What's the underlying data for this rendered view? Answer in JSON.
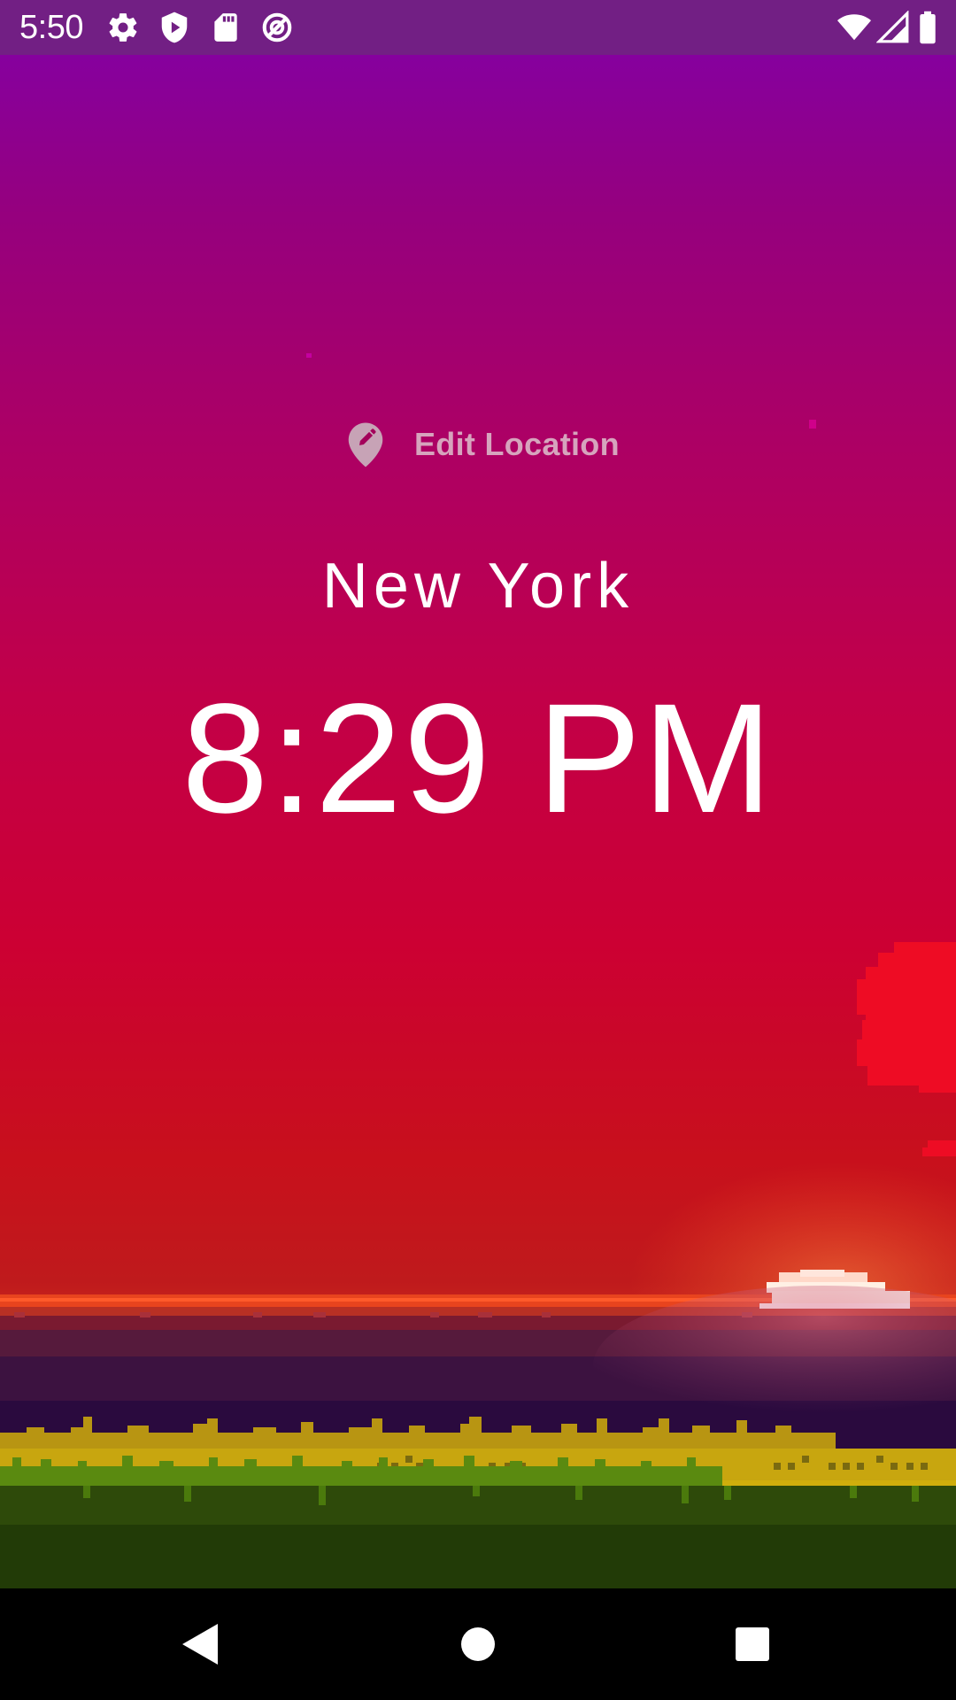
{
  "status_bar": {
    "time": "5:50",
    "left_icons": [
      "settings-icon",
      "shield-play-icon",
      "sd-card-icon",
      "no-disturb-icon"
    ],
    "right_icons": [
      "wifi-icon",
      "cell-signal-icon",
      "battery-icon"
    ]
  },
  "app": {
    "edit_location_label": "Edit Location",
    "location_icon": "location-pin-edit-icon",
    "city": "New York",
    "time": "8:29 PM"
  },
  "nav_bar": {
    "buttons": [
      "back-icon",
      "home-icon",
      "recents-icon"
    ]
  },
  "colors": {
    "status_bar": "#721f84",
    "sky_top": "#86009e",
    "sky_mid": "#c20048",
    "sky_low": "#c8101c",
    "sun": "#fff2d8",
    "water": "#3a1040",
    "grass_yellow": "#c4a410",
    "grass_dark": "#243d08",
    "label_muted": "#d6a4bd",
    "text": "#ffffff"
  }
}
